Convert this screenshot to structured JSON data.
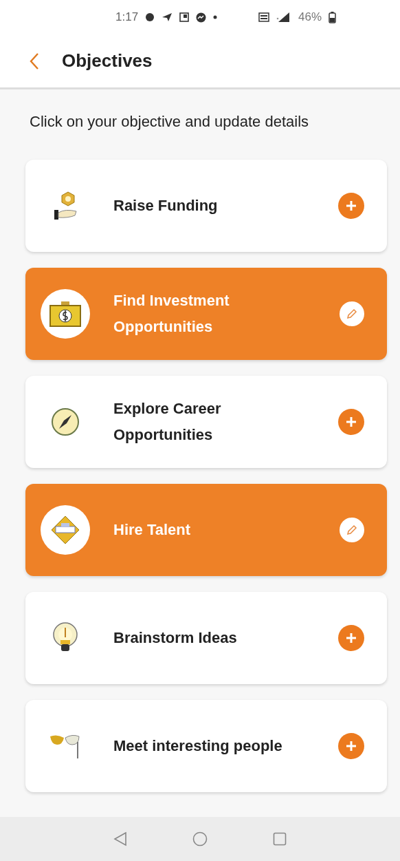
{
  "status_bar": {
    "time": "1:17",
    "battery": "46%"
  },
  "header": {
    "title": "Objectives"
  },
  "intro": "Click on your objective and update details",
  "objectives": [
    {
      "label": "Raise Funding",
      "selected": false
    },
    {
      "label": "Find Investment Opportunities",
      "selected": true
    },
    {
      "label": "Explore Career Opportunities",
      "selected": false
    },
    {
      "label": "Hire Talent",
      "selected": true
    },
    {
      "label": "Brainstorm Ideas",
      "selected": false
    },
    {
      "label": "Meet interesting people",
      "selected": false
    }
  ]
}
